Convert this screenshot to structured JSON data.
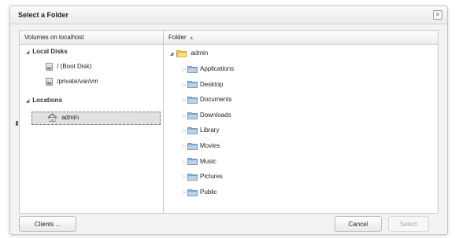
{
  "dialog": {
    "title": "Select a Folder",
    "close_glyph": "×"
  },
  "volumes": {
    "header": "Volumes on localhost",
    "groups": [
      {
        "label": "Local Disks",
        "items": [
          {
            "label": "/ (Boot Disk)",
            "icon": "disk-icon"
          },
          {
            "label": "/private/var/vm",
            "icon": "disk-icon"
          }
        ]
      },
      {
        "label": "Locations",
        "items": [
          {
            "label": "admin",
            "icon": "home-icon",
            "selected": true
          }
        ]
      }
    ]
  },
  "folders": {
    "header": "Folder",
    "sort_glyph": "▲",
    "root": {
      "label": "admin",
      "icon": "open-folder-icon",
      "expanded": true
    },
    "children": [
      {
        "label": "Applications"
      },
      {
        "label": "Desktop"
      },
      {
        "label": "Documents"
      },
      {
        "label": "Downloads"
      },
      {
        "label": "Library"
      },
      {
        "label": "Movies"
      },
      {
        "label": "Music"
      },
      {
        "label": "Pictures"
      },
      {
        "label": "Public"
      }
    ]
  },
  "footer": {
    "clients_label": "Clients ...",
    "cancel_label": "Cancel",
    "select_label": "Select"
  },
  "colors": {
    "folder": "#8cb4d8",
    "open_folder": "#f2c64a",
    "selection": "#e1e1e1"
  }
}
